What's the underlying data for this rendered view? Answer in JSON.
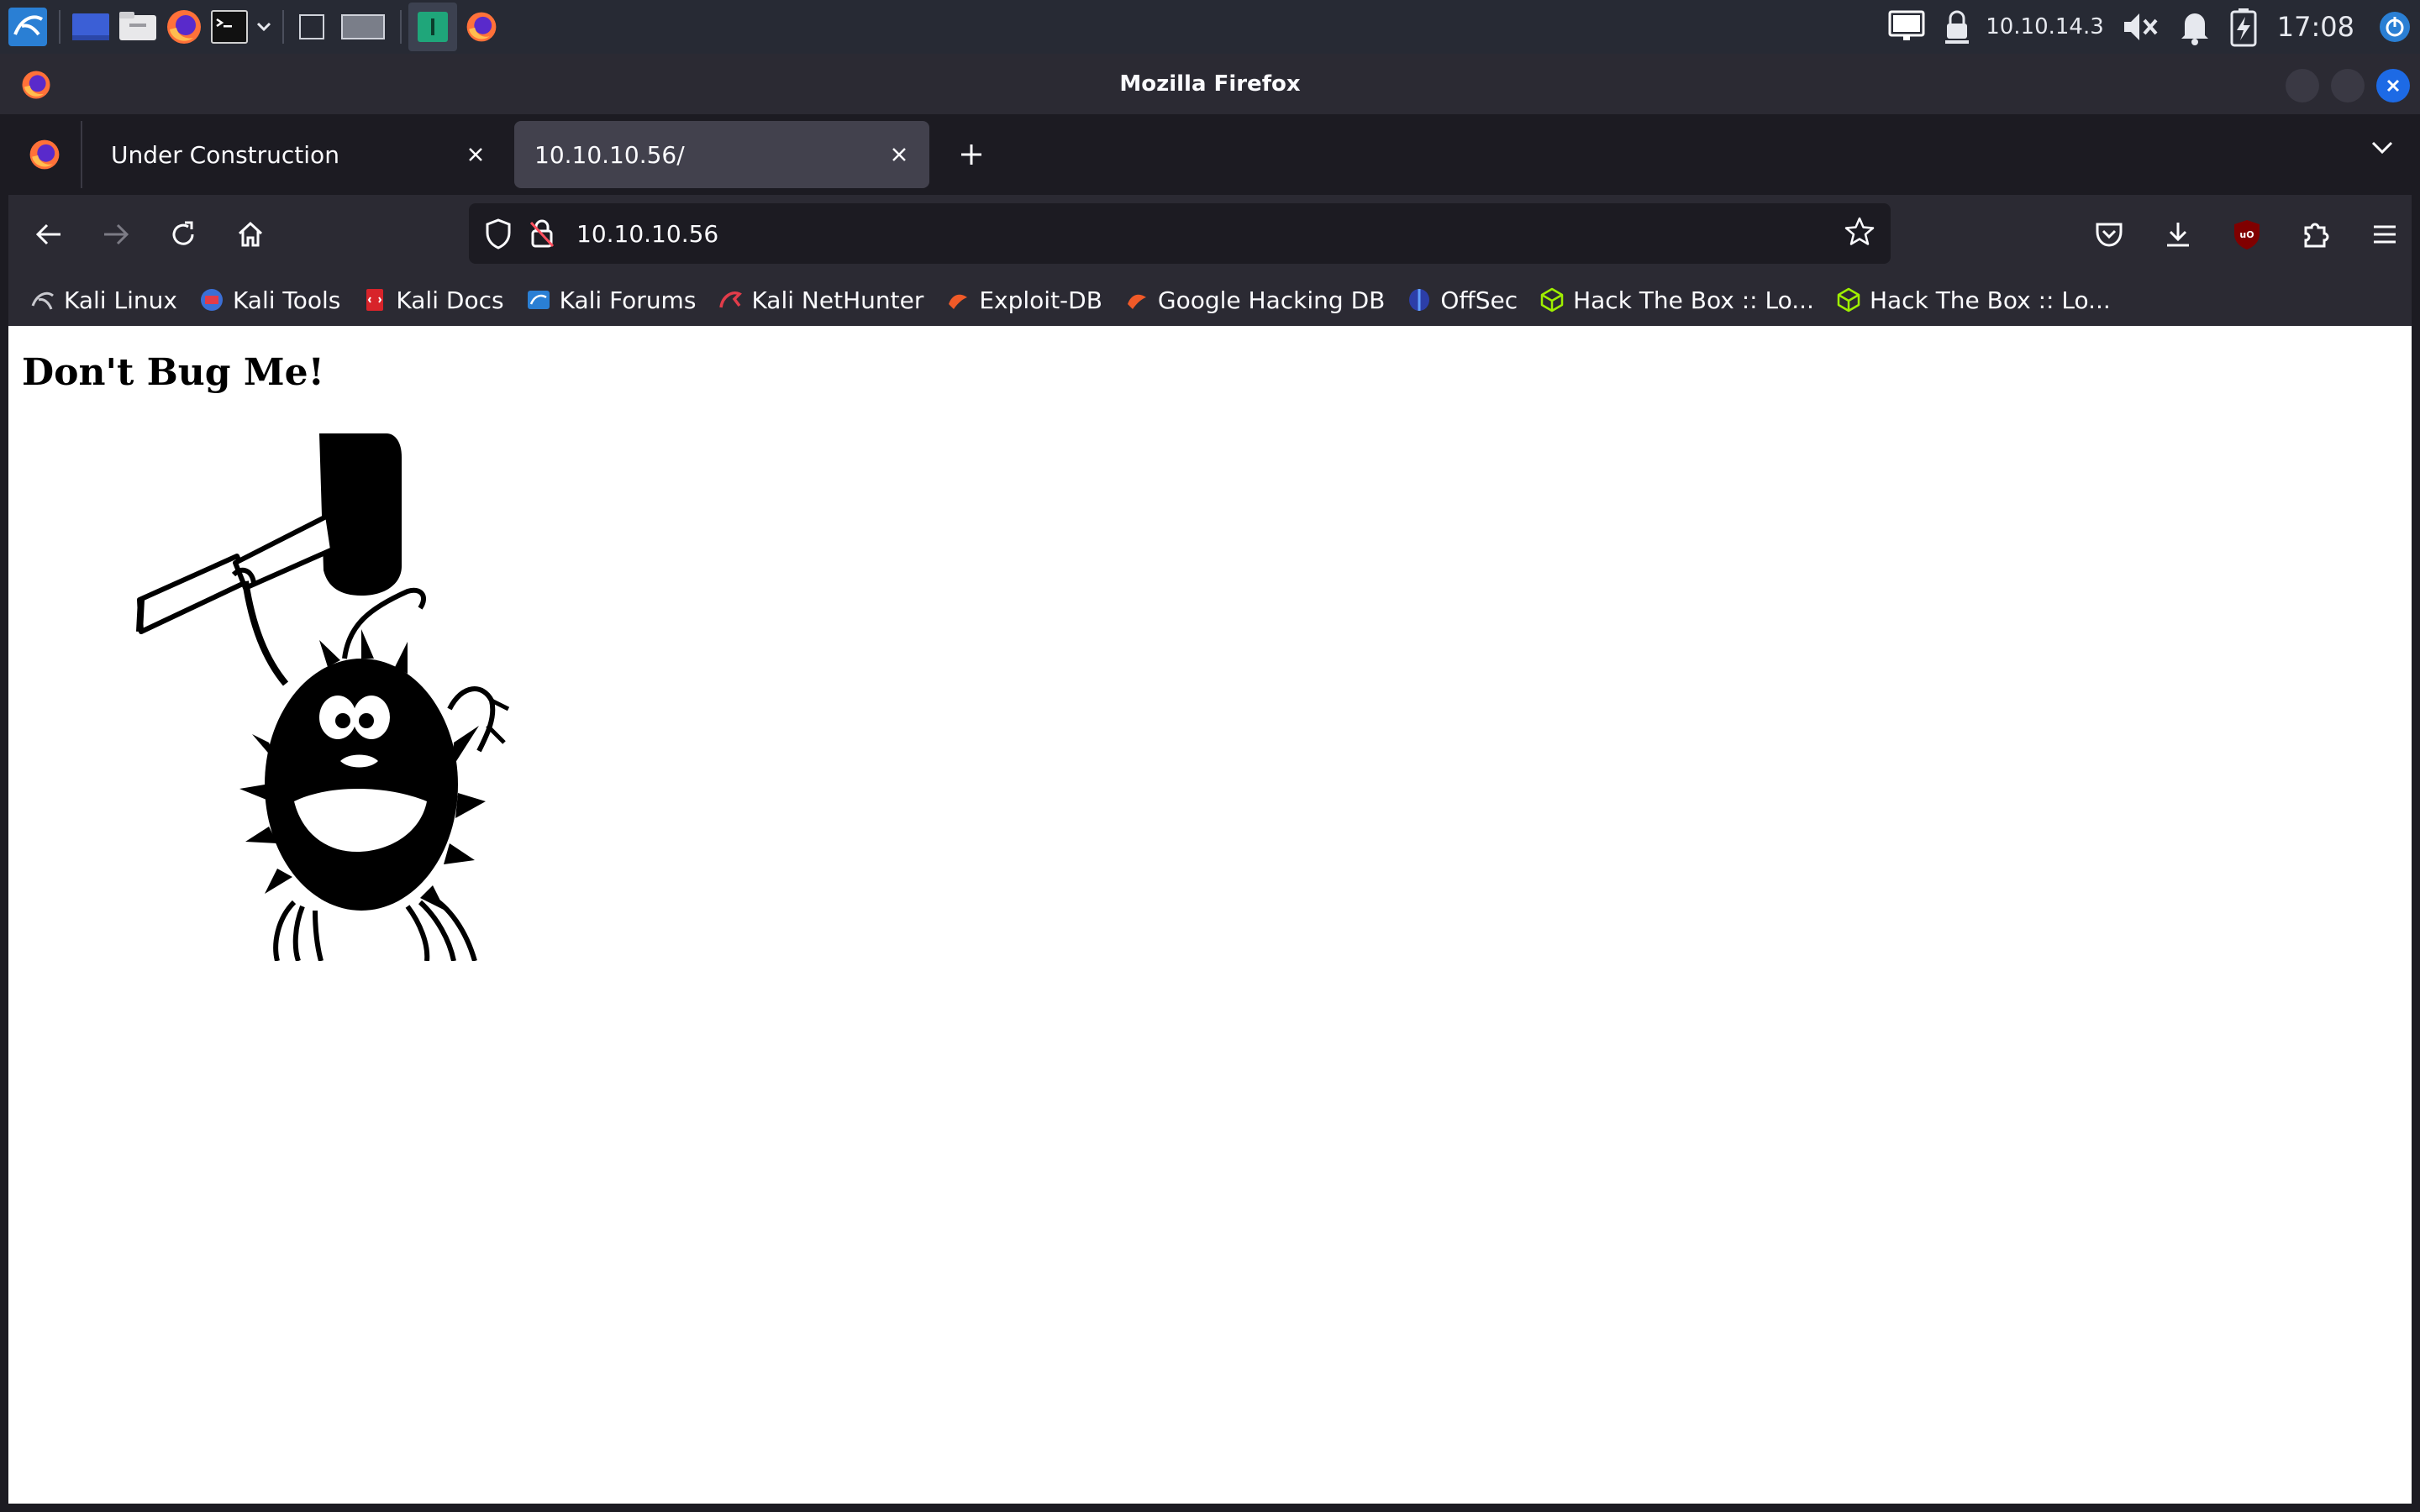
{
  "system_panel": {
    "network_ip": "10.10.14.3",
    "clock": "17:08"
  },
  "window": {
    "title": "Mozilla Firefox"
  },
  "tabs": [
    {
      "label": "Under Construction",
      "active": false
    },
    {
      "label": "10.10.10.56/",
      "active": true
    }
  ],
  "urlbar": {
    "url": "10.10.10.56"
  },
  "bookmarks": [
    {
      "label": "Kali Linux",
      "icon": "kali-dragon-icon"
    },
    {
      "label": "Kali Tools",
      "icon": "kali-tools-icon"
    },
    {
      "label": "Kali Docs",
      "icon": "kali-docs-icon"
    },
    {
      "label": "Kali Forums",
      "icon": "kali-forums-icon"
    },
    {
      "label": "Kali NetHunter",
      "icon": "nethunter-icon"
    },
    {
      "label": "Exploit-DB",
      "icon": "exploit-db-icon"
    },
    {
      "label": "Google Hacking DB",
      "icon": "ghdb-icon"
    },
    {
      "label": "OffSec",
      "icon": "offsec-icon"
    },
    {
      "label": "Hack The Box :: Lo...",
      "icon": "htb-cube-icon"
    },
    {
      "label": "Hack The Box :: Lo...",
      "icon": "htb-cube-icon"
    }
  ],
  "page": {
    "heading": "Don't Bug Me!",
    "image": "bug-with-hammer-illustration"
  },
  "colors": {
    "accent_blue": "#1d6ae5",
    "toolbar": "#2b2a33",
    "tabstrip": "#1c1b22",
    "active_tab": "#42414d",
    "htb_green": "#9fef00"
  }
}
